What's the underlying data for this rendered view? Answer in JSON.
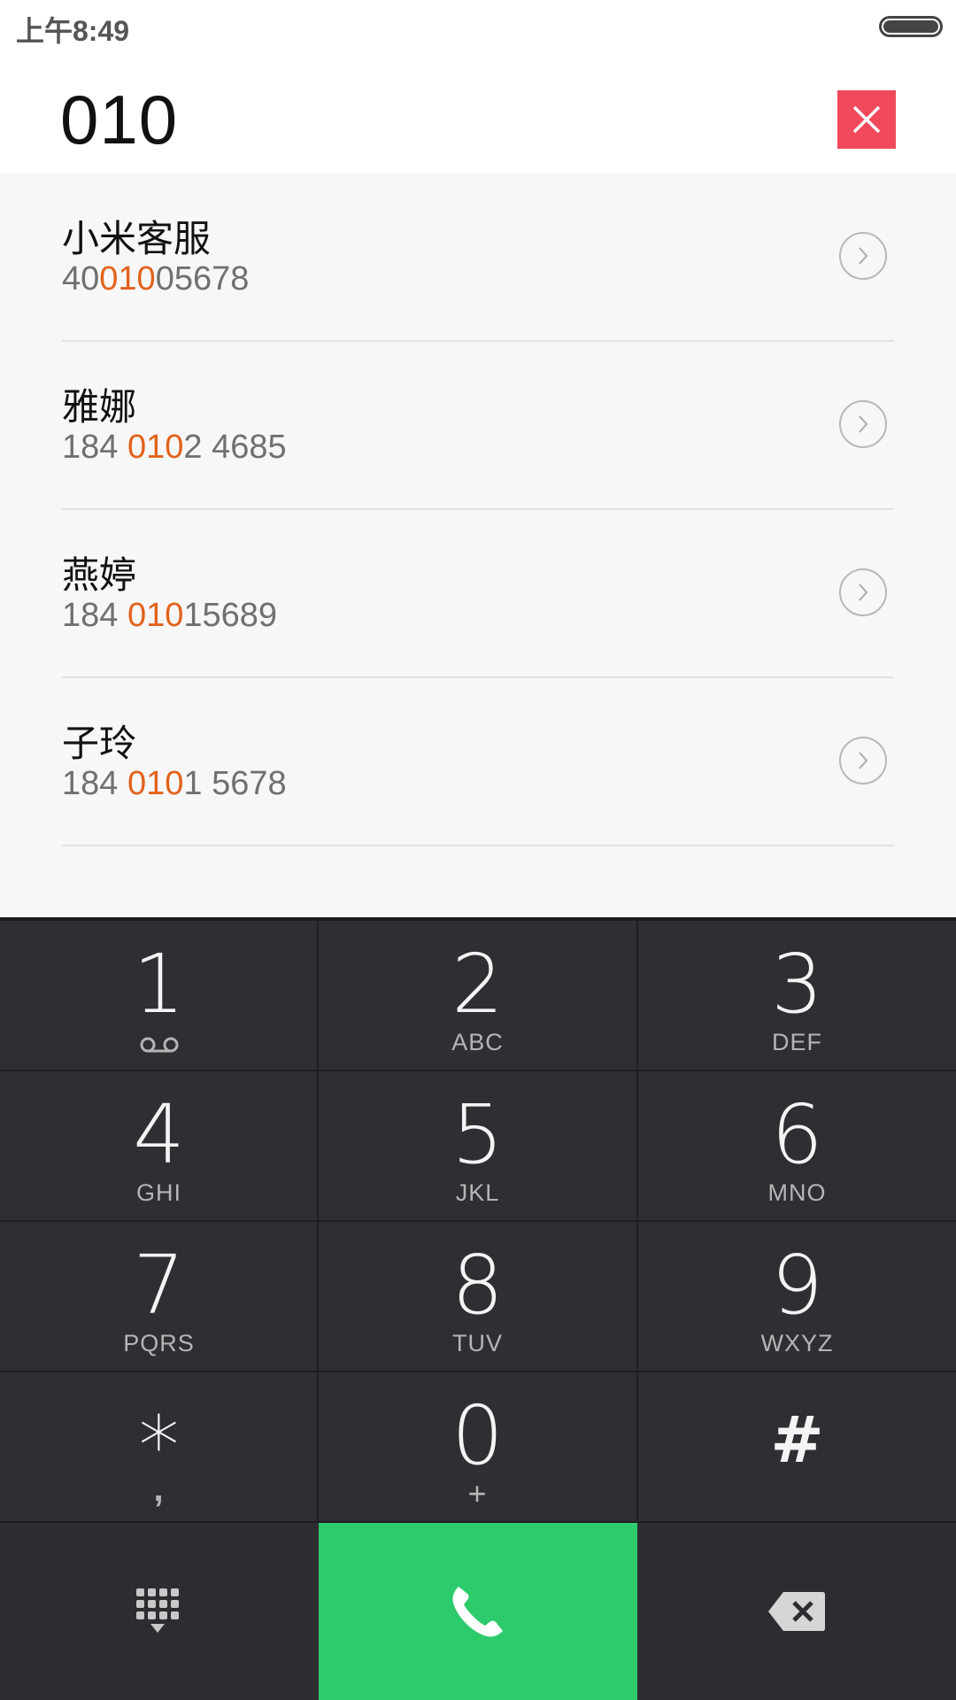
{
  "status_bar": {
    "time": "上午8:49"
  },
  "dialer": {
    "number": "010"
  },
  "results": [
    {
      "name": "小米客服",
      "number_pre": "40",
      "number_match": "010",
      "number_post": "05678"
    },
    {
      "name": "雅娜",
      "number_pre": "184 ",
      "number_match": "010",
      "number_post": "2 4685"
    },
    {
      "name": "燕婷",
      "number_pre": "184 ",
      "number_match": "010",
      "number_post": "15689"
    },
    {
      "name": "子玲",
      "number_pre": "184 ",
      "number_match": "010",
      "number_post": "1 5678"
    }
  ],
  "keypad": {
    "keys": [
      {
        "digit": "1",
        "letters": ""
      },
      {
        "digit": "2",
        "letters": "ABC"
      },
      {
        "digit": "3",
        "letters": "DEF"
      },
      {
        "digit": "4",
        "letters": "GHI"
      },
      {
        "digit": "5",
        "letters": "JKL"
      },
      {
        "digit": "6",
        "letters": "MNO"
      },
      {
        "digit": "7",
        "letters": "PQRS"
      },
      {
        "digit": "8",
        "letters": "TUV"
      },
      {
        "digit": "9",
        "letters": "WXYZ"
      },
      {
        "digit": "*",
        "letters": ","
      },
      {
        "digit": "0",
        "letters": "+"
      },
      {
        "digit": "#",
        "letters": ""
      }
    ]
  },
  "colors": {
    "highlight": "#e2621c",
    "call_green": "#2ecb6c",
    "clear_red": "#f0495c",
    "keypad_bg": "#2e2f33"
  },
  "icons": {
    "clear": "close-icon",
    "detail": "chevron-right-circle-icon",
    "voicemail": "voicemail-icon",
    "dialpad": "dialpad-icon",
    "call": "phone-icon",
    "backspace": "backspace-icon"
  }
}
